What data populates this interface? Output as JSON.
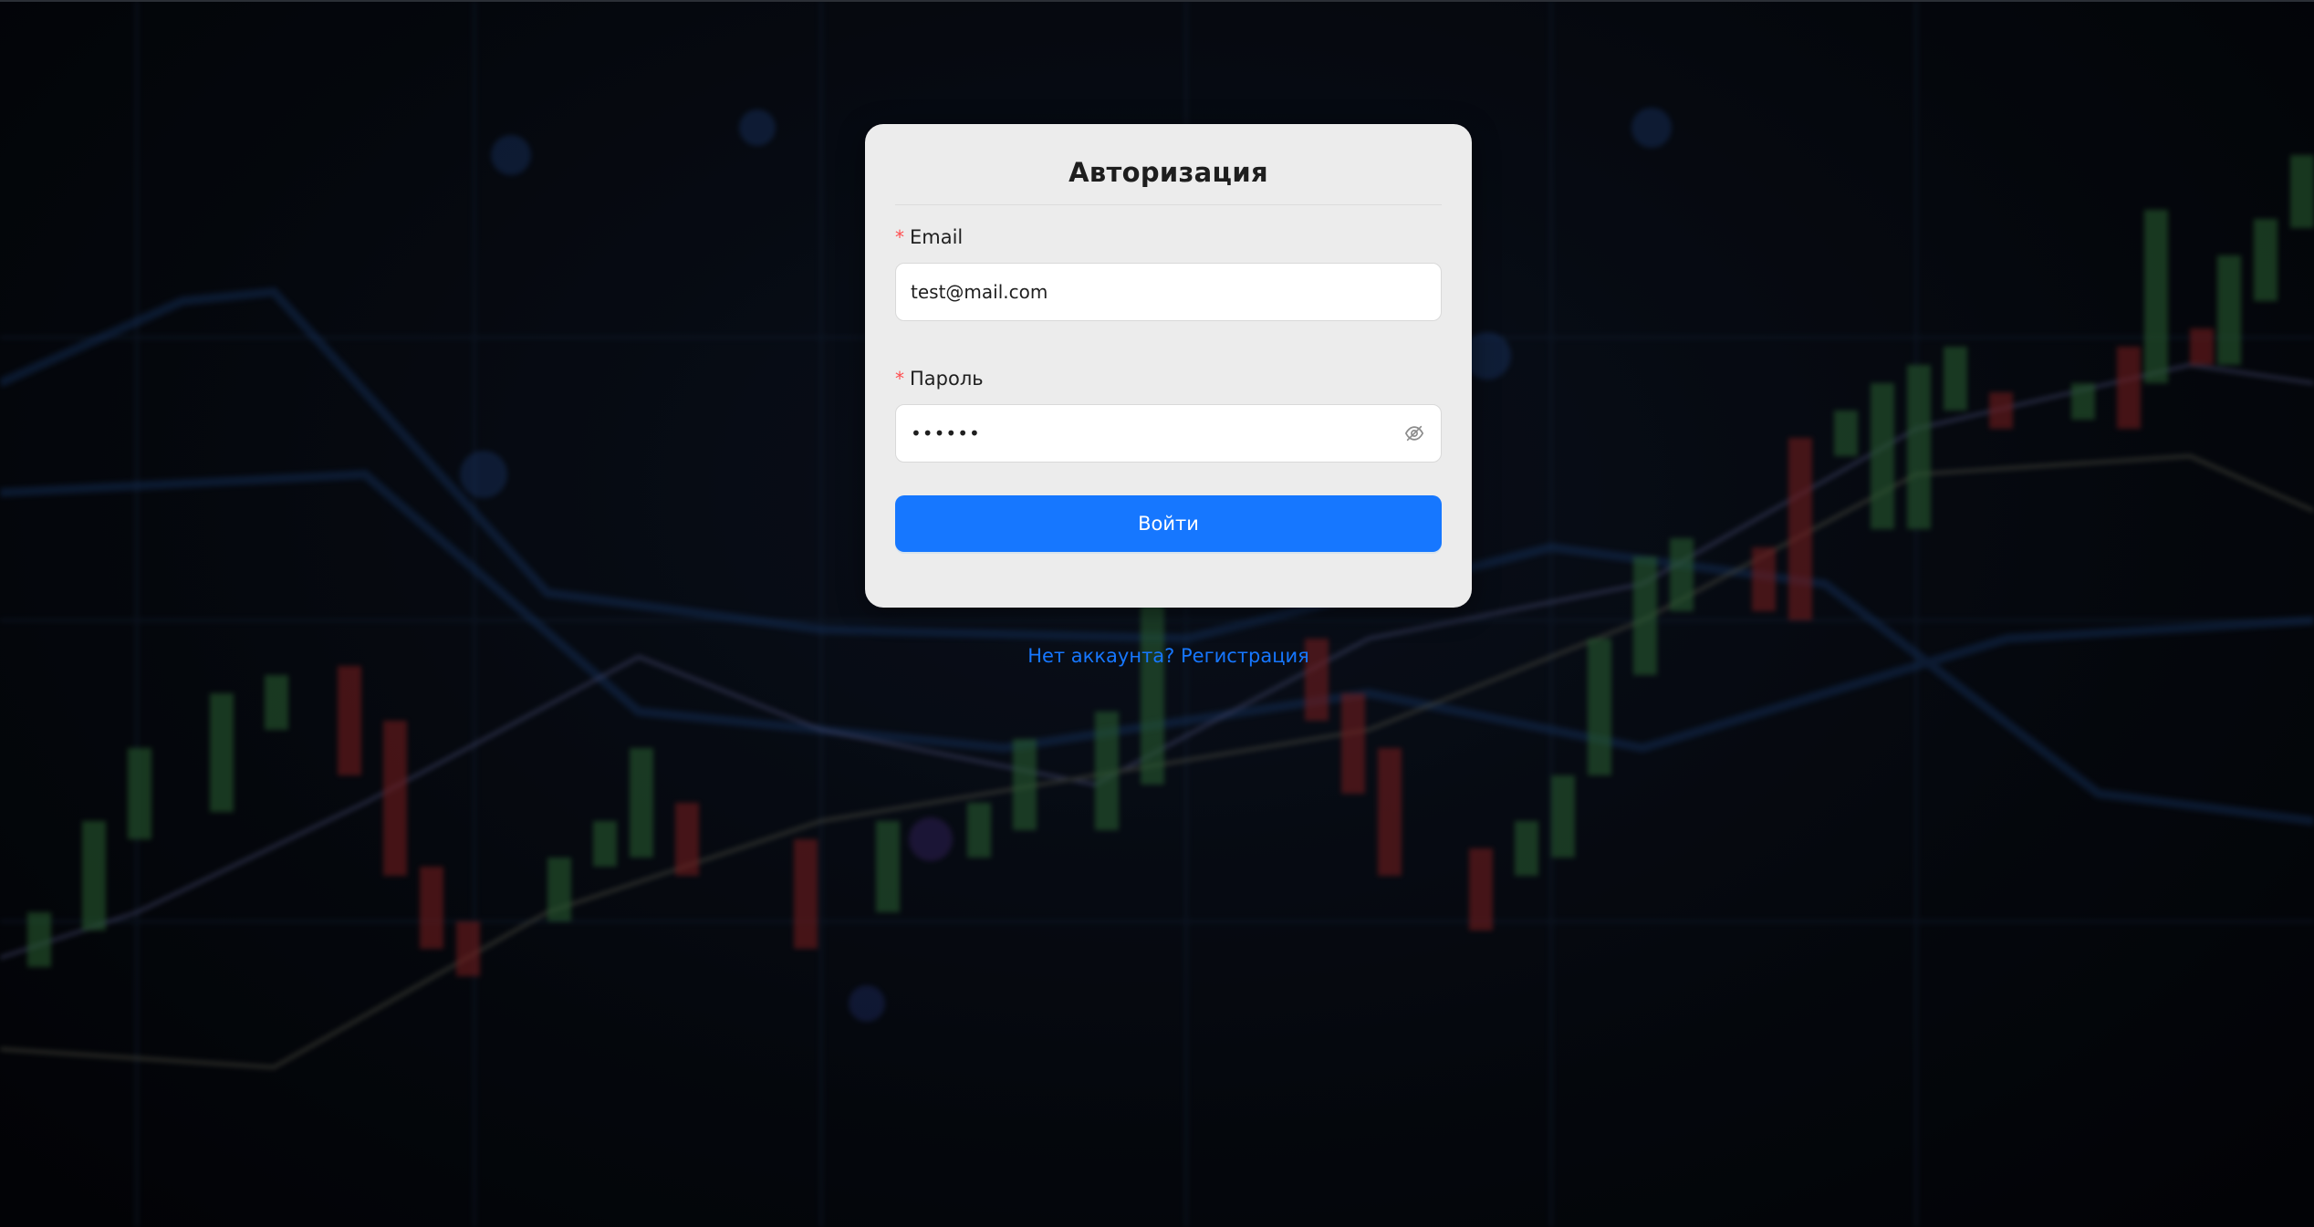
{
  "login_form": {
    "title": "Авторизация",
    "email_label": "Email",
    "email_value": "test@mail.com",
    "password_label": "Пароль",
    "password_masked": "••••••",
    "submit_label": "Войти"
  },
  "register_link": {
    "label": "Нет аккаунта? Регистрация"
  },
  "icons": {
    "password_toggle": "eye-invisible-icon"
  },
  "colors": {
    "primary": "#1677ff",
    "required_marker": "#ff4d4f",
    "card_background": "#ececec"
  }
}
